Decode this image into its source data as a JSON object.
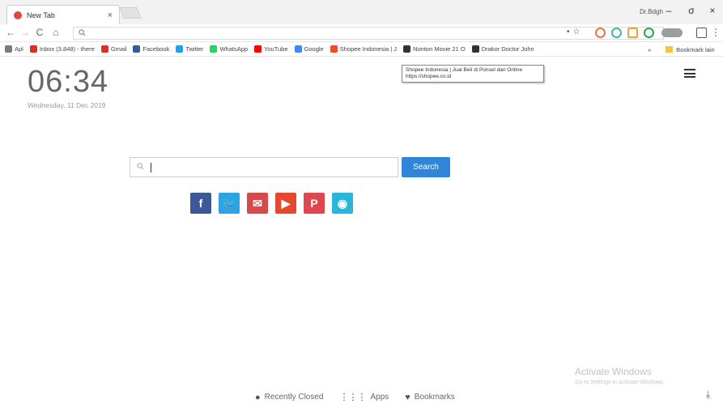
{
  "browser": {
    "tab_title": "New Tab",
    "tab_close": "×",
    "profile_name": "Dr.Bdgh",
    "win_minimize": "–",
    "win_maximize": "σ",
    "win_close": "×",
    "nav_back": "←",
    "nav_forward": "→",
    "nav_reload": "C",
    "nav_home": "⌂",
    "omnibox_value": "",
    "omnibox_icon": "search-icon",
    "menu_dots": "⋮"
  },
  "bookmarks_bar": {
    "items": [
      {
        "label": "Apl",
        "icon": "apps-grid-icon",
        "color": "#7a7a7a"
      },
      {
        "label": "Inbox (3.848) - there",
        "icon": "gmail-icon",
        "color": "#d93025"
      },
      {
        "label": "Gmail",
        "icon": "gmail-icon",
        "color": "#d93025"
      },
      {
        "label": "Facebook",
        "icon": "facebook-icon",
        "color": "#3b5998"
      },
      {
        "label": "Twitter",
        "icon": "twitter-icon",
        "color": "#1da1f2"
      },
      {
        "label": "WhatsApp",
        "icon": "whatsapp-icon",
        "color": "#25d366"
      },
      {
        "label": "YouTube",
        "icon": "youtube-icon",
        "color": "#ff0000"
      },
      {
        "label": "Google",
        "icon": "google-icon",
        "color": "#4285f4"
      },
      {
        "label": "Shopee Indonesia | J",
        "icon": "shopee-icon",
        "color": "#ee4d2d"
      },
      {
        "label": "Nonton Movie 21 O",
        "icon": "movie-icon",
        "color": "#333333"
      },
      {
        "label": "Drakor Doctor John",
        "icon": "movie-icon",
        "color": "#333333"
      }
    ],
    "overflow": "»",
    "other_bookmarks": "Bookmark lain"
  },
  "tooltip": {
    "line1": "Shopee Indonesia | Jual Beli di Ponsel dan Online",
    "line2": "https://shopee.co.id"
  },
  "clock": {
    "time": "06:34",
    "date": "Wednesday, 11 Dec 2019"
  },
  "search": {
    "placeholder": "",
    "button_label": "Search"
  },
  "socials": [
    {
      "glyph": "f",
      "icon": "facebook-icon",
      "color": "#3b5998"
    },
    {
      "glyph": "🐦",
      "icon": "twitter-icon",
      "color": "#2ba3e4"
    },
    {
      "glyph": "✉",
      "icon": "mail-icon",
      "color": "#d54b4b"
    },
    {
      "glyph": "▶",
      "icon": "youtube-icon",
      "color": "#e5482e"
    },
    {
      "glyph": "P",
      "icon": "pinterest-icon",
      "color": "#e0464f"
    },
    {
      "glyph": "◉",
      "icon": "vine-icon",
      "color": "#2ab5d9"
    }
  ],
  "watermark": {
    "title": "Activate Windows",
    "subtitle": "Go to Settings to activate Windows."
  },
  "bottom_nav": {
    "recently_closed": "Recently Closed",
    "apps": "Apps",
    "bookmarks": "Bookmarks"
  }
}
